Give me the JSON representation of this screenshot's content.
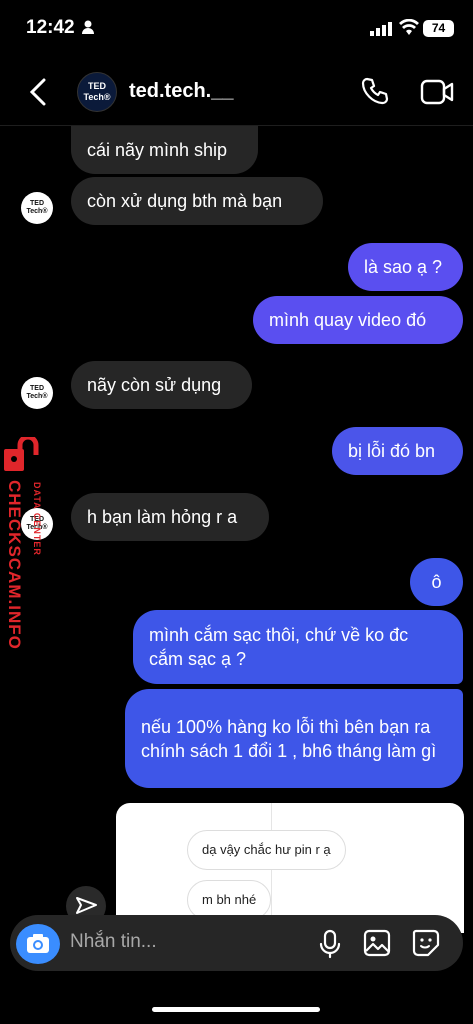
{
  "status": {
    "time": "12:42",
    "battery": "74"
  },
  "header": {
    "username": "ted.tech.__",
    "avatar_line1": "TED",
    "avatar_line2": "Tech®"
  },
  "messages": [
    {
      "side": "in",
      "text": "cái nãy mình ship"
    },
    {
      "side": "in",
      "text": "còn xử dụng bth mà bạn"
    },
    {
      "side": "out",
      "text": "là sao ạ ?"
    },
    {
      "side": "out",
      "text": "mình quay video đó"
    },
    {
      "side": "in",
      "text": "nãy còn sử dụng"
    },
    {
      "side": "out",
      "text": "bị lỗi đó bn"
    },
    {
      "side": "in",
      "text": "h bạn làm hỏng r a"
    },
    {
      "side": "out",
      "text": "ô"
    },
    {
      "side": "out",
      "text": "mình cắm sạc thôi, chứ về ko đc cắm sạc ạ ?"
    },
    {
      "side": "out",
      "text": "nếu 100% hàng ko lỗi thì bên bạn ra chính sách 1 đổi 1 , bh6 tháng làm gì"
    }
  ],
  "screenshot_card": {
    "bubble1": "dạ vậy chắc hư pin r ạ",
    "bubble2": "m bh nhé"
  },
  "watermark": {
    "main": "CHECKSCAM.INFO",
    "sub": "DATA CENTER"
  },
  "composer": {
    "placeholder": "Nhắn tin..."
  },
  "colors": {
    "outgoing_blue": "#3e56e8",
    "outgoing_purple": "#5a4ff0",
    "incoming": "#262626",
    "watermark_red": "#e0262b"
  },
  "icons": [
    "back-chevron-icon",
    "phone-icon",
    "video-call-icon",
    "share-icon",
    "camera-icon",
    "microphone-icon",
    "gallery-icon",
    "sticker-icon",
    "lock-icon"
  ]
}
